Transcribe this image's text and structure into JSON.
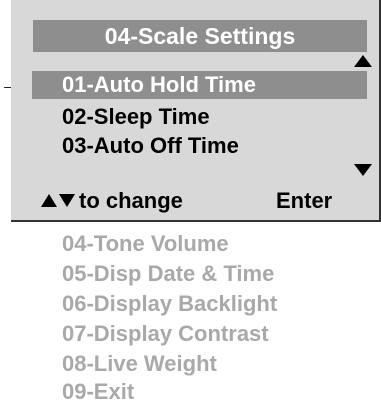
{
  "screen": {
    "title": "04-Scale Settings",
    "cursor_glyph": "→",
    "visible_items": [
      {
        "label": "01-Auto Hold Time",
        "selected": true
      },
      {
        "label": "02-Sleep Time",
        "selected": false
      },
      {
        "label": "03-Auto Off Time",
        "selected": false
      }
    ],
    "scroll_up_icon": "triangle-up",
    "scroll_down_icon": "triangle-down",
    "footer": {
      "change_hint": "to change",
      "enter_label": "Enter"
    }
  },
  "offscreen_items": [
    "04-Tone Volume",
    "05-Disp Date & Time",
    "06-Display Backlight",
    "07-Display Contrast",
    "08-Live Weight",
    "09-Exit"
  ],
  "colors": {
    "screen_bg": "#d8d8d8",
    "highlight_bg": "#8e8e8e",
    "highlight_text": "#ffffff",
    "offscreen_text": "#a9a9a9"
  }
}
